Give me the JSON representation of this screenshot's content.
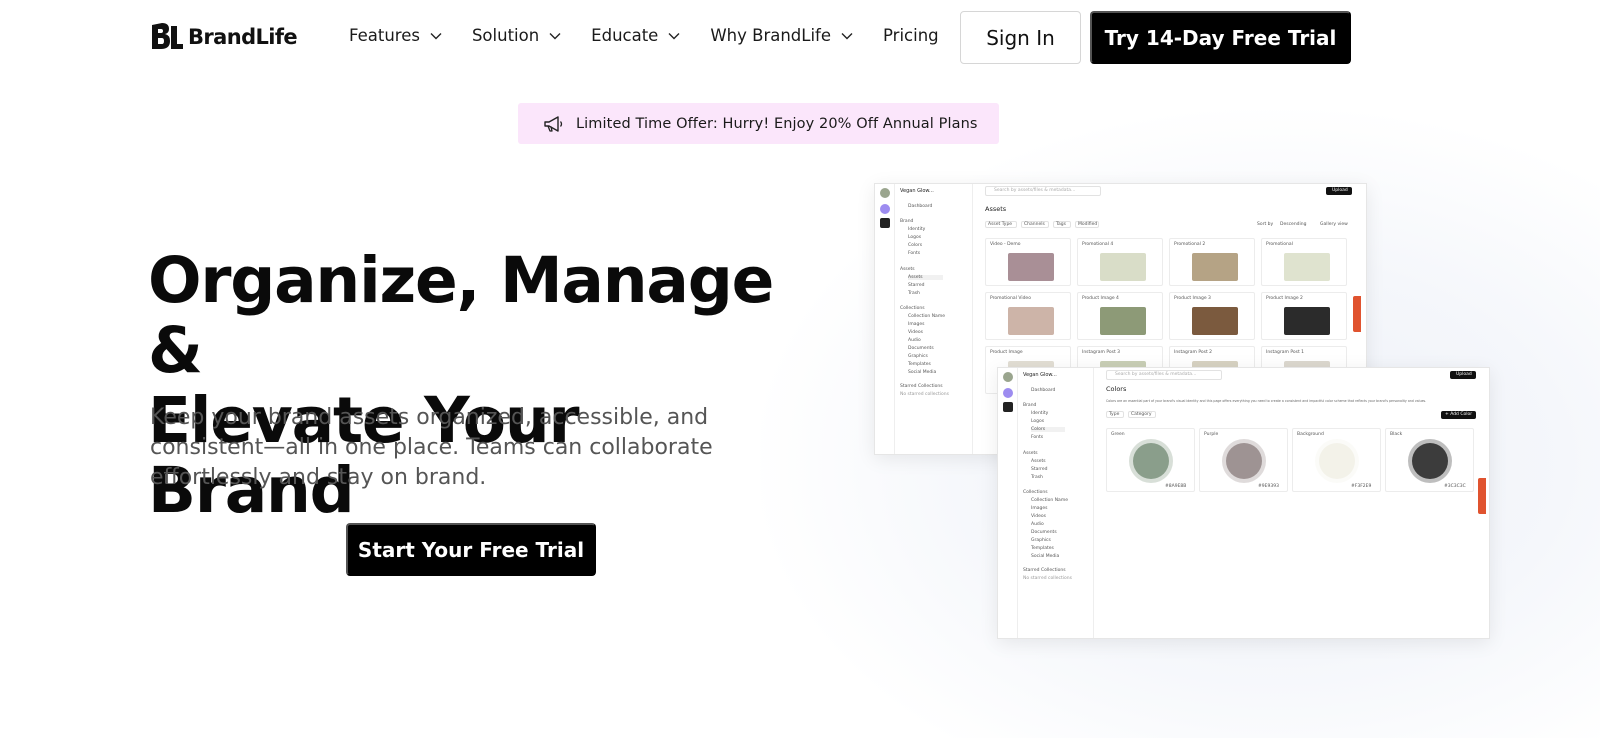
{
  "brand": {
    "name": "BrandLife",
    "logo_mark": "BL"
  },
  "nav": {
    "items": [
      {
        "label": "Features",
        "has_dropdown": true
      },
      {
        "label": "Solution",
        "has_dropdown": true
      },
      {
        "label": "Educate",
        "has_dropdown": true
      },
      {
        "label": "Why BrandLife",
        "has_dropdown": true
      },
      {
        "label": "Pricing",
        "has_dropdown": false
      }
    ],
    "sign_in": "Sign In",
    "trial": "Try 14-Day Free Trial"
  },
  "promo": {
    "icon": "megaphone-icon",
    "text": "Limited Time Offer: Hurry! Enjoy 20% Off Annual Plans"
  },
  "hero": {
    "title_line1": "Organize, Manage &",
    "title_line2": "Elevate Your Brand",
    "subtitle": "Keep your brand assets organized, accessible, and consistent—all in one place. Teams can collaborate effortlessly and stay on brand.",
    "cta": "Start Your Free Trial"
  },
  "screenshot_assets": {
    "workspace": "Vegan Glow...",
    "search_placeholder": "Search by assets/files & metadata...",
    "upload": "Upload",
    "heading": "Assets",
    "filters": [
      "Asset Type",
      "Channels",
      "Tags",
      "Modified"
    ],
    "tools": [
      "Sort by",
      "Descending",
      "Gallery view"
    ],
    "sidebar": [
      "Dashboard",
      "Brand",
      "Identity",
      "Logos",
      "Colors",
      "Fonts",
      "Assets",
      "Assets",
      "Starred",
      "Trash",
      "Collections",
      "Collection Name",
      "Images",
      "Videos",
      "Audio",
      "Documents",
      "Graphics",
      "Templates",
      "Social Media",
      "Starred Collections",
      "No starred collections"
    ],
    "cards": [
      {
        "label": "Video - Demo",
        "color": "#a98f96"
      },
      {
        "label": "Promotional 4",
        "color": "#d9ddc8"
      },
      {
        "label": "Promotional 2",
        "color": "#b5a385"
      },
      {
        "label": "Promotional",
        "color": "#dfe3cf"
      },
      {
        "label": "Promotional Video",
        "color": "#cdb4a8"
      },
      {
        "label": "Product Image 4",
        "color": "#8d9a77"
      },
      {
        "label": "Product Image 3",
        "color": "#7b5a3e"
      },
      {
        "label": "Product Image 2",
        "color": "#2b2b2b"
      },
      {
        "label": "Product Image",
        "color": "#e2ded4"
      },
      {
        "label": "Instagram Post 3",
        "color": "#c9cfb6"
      },
      {
        "label": "Instagram Post 2",
        "color": "#d7d2c2"
      },
      {
        "label": "Instagram Post 1",
        "color": "#dcd8cf"
      }
    ]
  },
  "screenshot_colors": {
    "workspace": "Vegan Glow...",
    "search_placeholder": "Search by assets/files & metadata...",
    "upload": "Upload",
    "heading": "Colors",
    "description": "Colors are an essential part of your brand's visual identity and this page offers everything you need to create a consistent and impactful color scheme that reflects your brand's personality and values.",
    "filters": [
      "Type",
      "Category"
    ],
    "add_color": "+ Add Color",
    "swatches": [
      {
        "name": "Green",
        "hex": "#8A9E8B",
        "code": "#8A9E8B"
      },
      {
        "name": "Purple",
        "hex": "#9E9393",
        "code": "#9E9393"
      },
      {
        "name": "Background",
        "hex": "#F3F2E9",
        "code": "#F3F2E9"
      },
      {
        "name": "Black",
        "hex": "#3C3C3C",
        "code": "#3C3C3C"
      }
    ],
    "sidebar": [
      "Dashboard",
      "Brand",
      "Identity",
      "Logos",
      "Colors",
      "Fonts",
      "Assets",
      "Assets",
      "Starred",
      "Trash",
      "Collections",
      "Collection Name",
      "Images",
      "Videos",
      "Audio",
      "Documents",
      "Graphics",
      "Templates",
      "Social Media",
      "Starred Collections",
      "No starred collections"
    ]
  },
  "feedback_label": "Feedback"
}
